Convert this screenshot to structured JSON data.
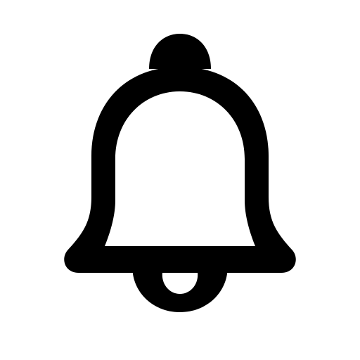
{
  "icon": {
    "name": "bell-icon",
    "color": "#000000",
    "background": "#ffffff"
  }
}
